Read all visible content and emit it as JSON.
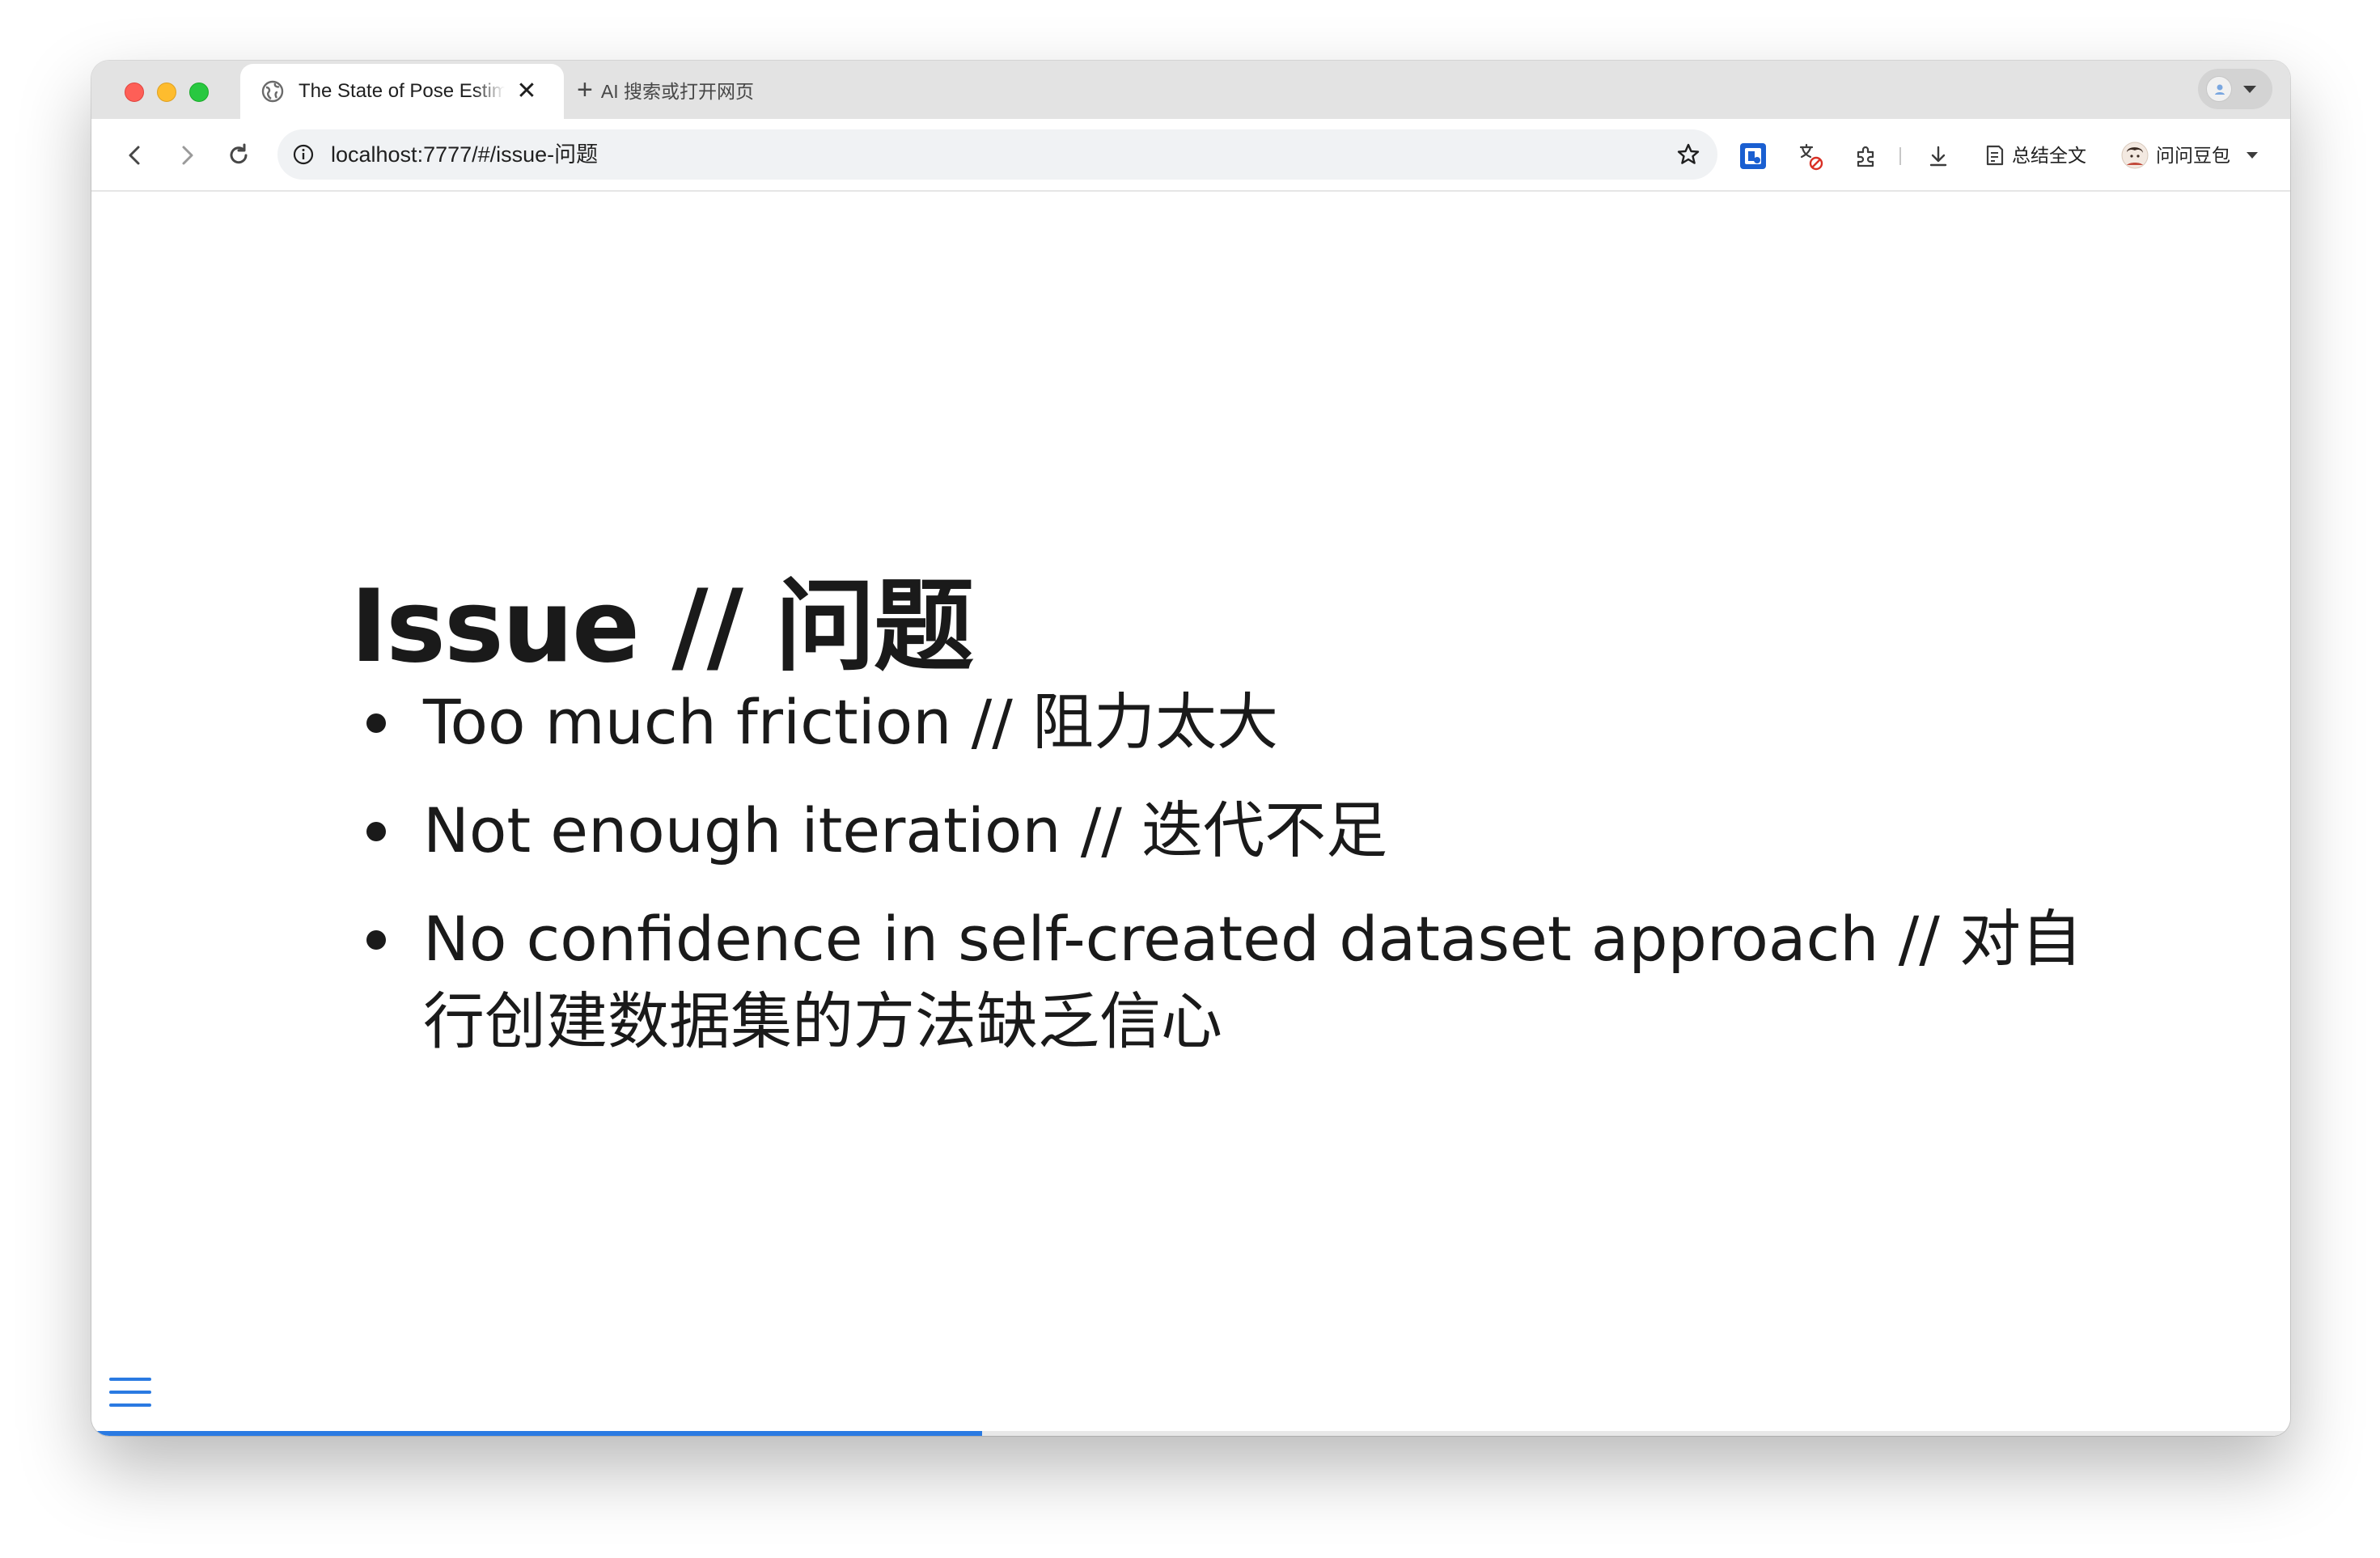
{
  "browser": {
    "tab": {
      "title": "The State of Pose Estimation",
      "close_glyph": "✕"
    },
    "new_tab": {
      "plus_glyph": "+",
      "label": "AI 搜索或打开网页"
    },
    "address_bar": {
      "url": "localhost:7777/#/issue-问题"
    },
    "toolbar": {
      "summarize_label": "总结全文",
      "doubao_label": "问问豆包"
    }
  },
  "slide": {
    "title": "Issue // 问题",
    "bullets": [
      "Too much friction // 阻力太大",
      "Not enough iteration // 迭代不足",
      "No confidence in self-created dataset approach // 对自行创建数据集的方法缺乏信心"
    ],
    "progress_fraction": 0.405,
    "accent_color": "#2a7ae2"
  }
}
